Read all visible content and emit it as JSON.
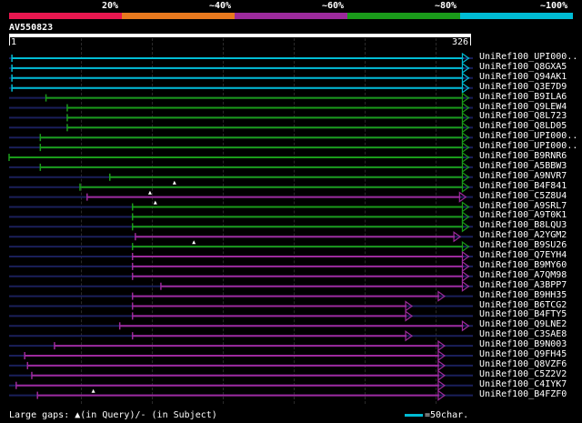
{
  "legend": {
    "segments": [
      {
        "color": "#e8174f",
        "pct": "20%"
      },
      {
        "color": "#e8791e",
        "pct": "~40%"
      },
      {
        "color": "#9c2a9c",
        "pct": "~60%"
      },
      {
        "color": "#1a9b1a",
        "pct": "~80%"
      },
      {
        "color": "#00bcd4",
        "pct": "~100%"
      }
    ]
  },
  "query": {
    "id": "AV550823",
    "start": "1",
    "end": "326"
  },
  "colors": {
    "cyan": "#00bcd4",
    "green": "#1a9b1a",
    "purple": "#9c2a9c",
    "faint": "#1a1f5a",
    "marker": "#ffffff"
  },
  "hits": [
    {
      "label": "UniRef100_UPI000..",
      "color": "cyan",
      "start": 3,
      "end": 325
    },
    {
      "label": "UniRef100_Q8GXA5",
      "color": "cyan",
      "start": 3,
      "end": 325
    },
    {
      "label": "UniRef100_Q94AK1",
      "color": "cyan",
      "start": 3,
      "end": 325
    },
    {
      "label": "UniRef100_Q3E7D9",
      "color": "cyan",
      "start": 3,
      "end": 325
    },
    {
      "label": "UniRef100_B9ILA6",
      "color": "green",
      "start": 27,
      "end": 325
    },
    {
      "label": "UniRef100_Q9LEW4",
      "color": "green",
      "start": 42,
      "end": 325
    },
    {
      "label": "UniRef100_Q8L723",
      "color": "green",
      "start": 42,
      "end": 325
    },
    {
      "label": "UniRef100_Q8LD05",
      "color": "green",
      "start": 42,
      "end": 325
    },
    {
      "label": "UniRef100_UPI000..",
      "color": "green",
      "start": 23,
      "end": 325
    },
    {
      "label": "UniRef100_UPI000..",
      "color": "green",
      "start": 23,
      "end": 325
    },
    {
      "label": "UniRef100_B9RNR6",
      "color": "green",
      "start": 1,
      "end": 325
    },
    {
      "label": "UniRef100_A5BBW3",
      "color": "green",
      "start": 23,
      "end": 325
    },
    {
      "label": "UniRef100_A9NVR7",
      "color": "green",
      "start": 72,
      "end": 325,
      "marker": true
    },
    {
      "label": "UniRef100_B4F841",
      "color": "green",
      "start": 51,
      "end": 325,
      "marker": true
    },
    {
      "label": "UniRef100_C5Z8U4",
      "color": "purple",
      "start": 56,
      "end": 323,
      "marker": true
    },
    {
      "label": "UniRef100_A9SRL7",
      "color": "green",
      "start": 88,
      "end": 325
    },
    {
      "label": "UniRef100_A9T0K1",
      "color": "green",
      "start": 88,
      "end": 325
    },
    {
      "label": "UniRef100_B8LQU3",
      "color": "green",
      "start": 88,
      "end": 325
    },
    {
      "label": "UniRef100_A2YGM2",
      "color": "purple",
      "start": 90,
      "end": 319,
      "marker": true
    },
    {
      "label": "UniRef100_B9SU26",
      "color": "green",
      "start": 88,
      "end": 325
    },
    {
      "label": "UniRef100_Q7EYH4",
      "color": "purple",
      "start": 88,
      "end": 325
    },
    {
      "label": "UniRef100_B9MY60",
      "color": "purple",
      "start": 88,
      "end": 325
    },
    {
      "label": "UniRef100_A7QM98",
      "color": "purple",
      "start": 88,
      "end": 325
    },
    {
      "label": "UniRef100_A3BPP7",
      "color": "purple",
      "start": 108,
      "end": 325
    },
    {
      "label": "UniRef100_B9HH35",
      "color": "purple",
      "start": 88,
      "end": 308
    },
    {
      "label": "UniRef100_B6TCG2",
      "color": "purple",
      "start": 88,
      "end": 285
    },
    {
      "label": "UniRef100_B4FTY5",
      "color": "purple",
      "start": 88,
      "end": 285
    },
    {
      "label": "UniRef100_Q9LNE2",
      "color": "purple",
      "start": 79,
      "end": 325
    },
    {
      "label": "UniRef100_C3SAE8",
      "color": "purple",
      "start": 88,
      "end": 285
    },
    {
      "label": "UniRef100_B9N003",
      "color": "purple",
      "start": 33,
      "end": 308
    },
    {
      "label": "UniRef100_Q9FH45",
      "color": "purple",
      "start": 12,
      "end": 308
    },
    {
      "label": "UniRef100_Q8VZF6",
      "color": "purple",
      "start": 14,
      "end": 308
    },
    {
      "label": "UniRef100_C5Z2V2",
      "color": "purple",
      "start": 17,
      "end": 308
    },
    {
      "label": "UniRef100_C4IYK7",
      "color": "purple",
      "start": 6,
      "end": 308,
      "marker": true
    },
    {
      "label": "UniRef100_B4FZF0",
      "color": "purple",
      "start": 21,
      "end": 308
    }
  ],
  "footer": {
    "text": "Large gaps: ▲(in Query)/- (in Subject)"
  },
  "scale": {
    "text": "=50char."
  }
}
